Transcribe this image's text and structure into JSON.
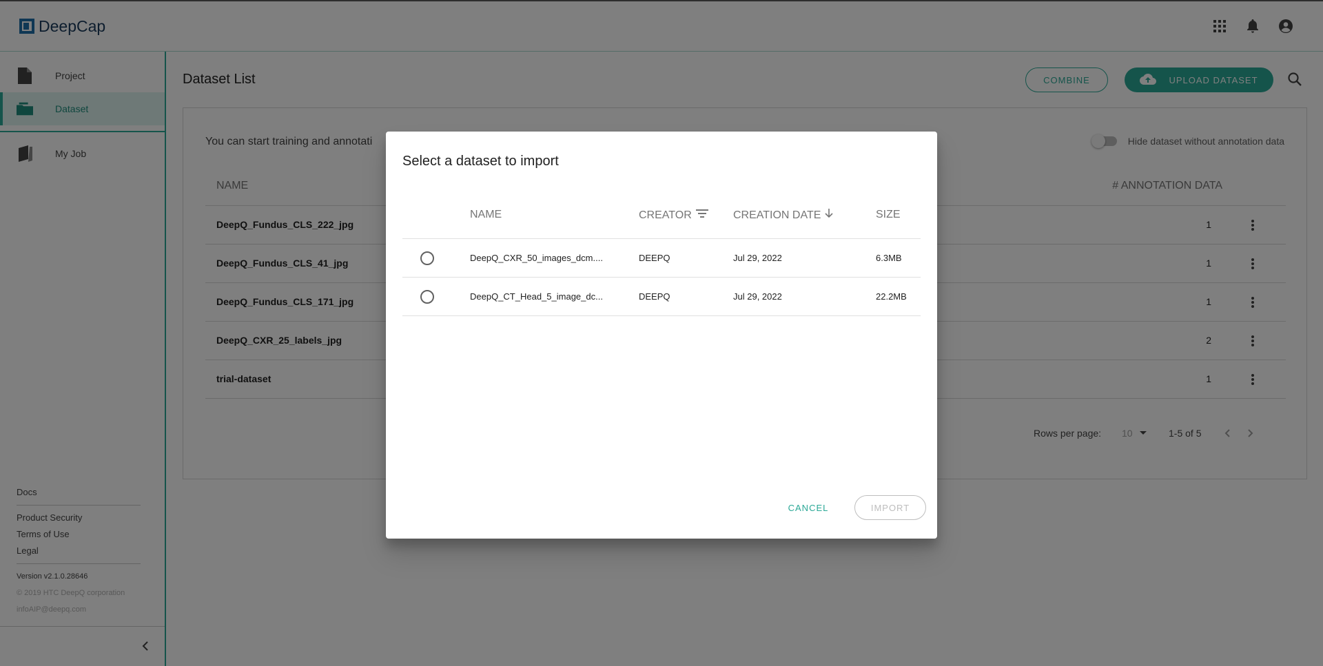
{
  "app": {
    "name": "DeepCap"
  },
  "header": {
    "icons": [
      "apps-grid-icon",
      "bell-icon",
      "account-icon"
    ]
  },
  "sidebar": {
    "items": [
      {
        "label": "Project",
        "icon": "file-icon",
        "active": false
      },
      {
        "label": "Dataset",
        "icon": "folder-open-icon",
        "active": true
      },
      {
        "label": "My Job",
        "icon": "book-icon",
        "active": false
      }
    ],
    "links": {
      "docs": "Docs",
      "product_security": "Product Security",
      "terms": "Terms of Use",
      "legal": "Legal",
      "version": "Version v2.1.0.28646",
      "copyright": "© 2019 HTC DeepQ corporation",
      "email": "infoAIP@deepq.com"
    }
  },
  "main": {
    "title": "Dataset List",
    "combine_label": "COMBINE",
    "upload_label": "UPLOAD DATASET",
    "hint": "You can start training and annotati",
    "toggle_label": "Hide dataset without annotation data",
    "columns": {
      "name": "NAME",
      "annotation": "# ANNOTATION DATA"
    },
    "rows": [
      {
        "name": "DeepQ_Fundus_CLS_222_jpg",
        "count": "1"
      },
      {
        "name": "DeepQ_Fundus_CLS_41_jpg",
        "count": "1"
      },
      {
        "name": "DeepQ_Fundus_CLS_171_jpg",
        "count": "1"
      },
      {
        "name": "DeepQ_CXR_25_labels_jpg",
        "count": "2"
      },
      {
        "name": "trial-dataset",
        "count": "1"
      }
    ],
    "pager": {
      "rows_label": "Rows per page:",
      "rows_value": "10",
      "range": "1-5 of 5"
    }
  },
  "dialog": {
    "title": "Select a dataset to import",
    "columns": {
      "name": "NAME",
      "creator": "CREATOR",
      "date": "CREATION DATE",
      "size": "SIZE"
    },
    "rows": [
      {
        "name": "DeepQ_CXR_50_images_dcm....",
        "creator": "DEEPQ",
        "date": "Jul 29, 2022",
        "size": "6.3MB"
      },
      {
        "name": "DeepQ_CT_Head_5_image_dc...",
        "creator": "DEEPQ",
        "date": "Jul 29, 2022",
        "size": "22.2MB"
      }
    ],
    "cancel_label": "CANCEL",
    "import_label": "IMPORT"
  },
  "colors": {
    "accent": "#2aa896",
    "brand": "#1e6fa8",
    "overlay": "rgba(0,0,0,0.5)"
  }
}
